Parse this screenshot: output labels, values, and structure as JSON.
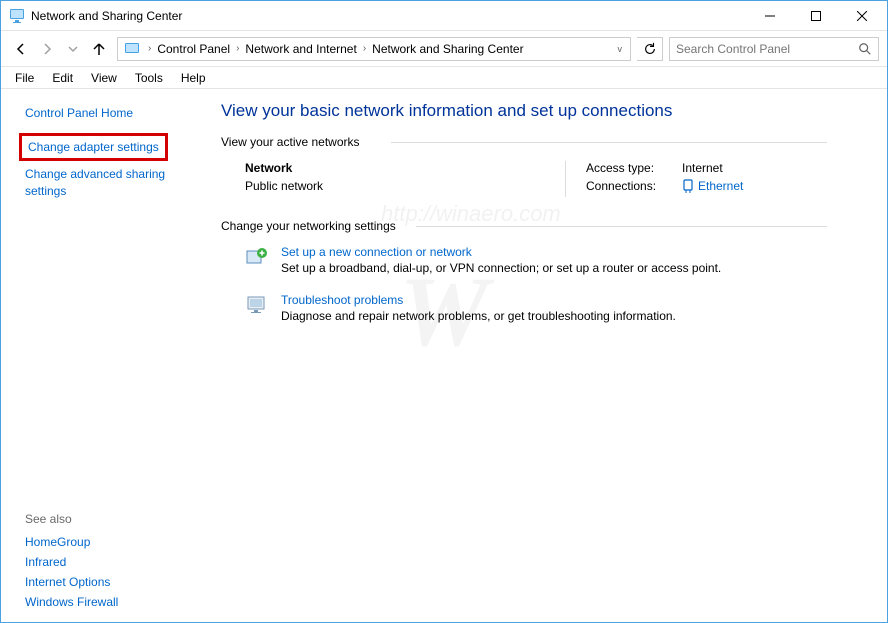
{
  "window": {
    "title": "Network and Sharing Center"
  },
  "breadcrumb": {
    "seg0": "Control Panel",
    "seg1": "Network and Internet",
    "seg2": "Network and Sharing Center"
  },
  "search": {
    "placeholder": "Search Control Panel"
  },
  "menu": {
    "file": "File",
    "edit": "Edit",
    "view": "View",
    "tools": "Tools",
    "help": "Help"
  },
  "sidebar": {
    "home": "Control Panel Home",
    "adapter": "Change adapter settings",
    "advanced": "Change advanced sharing settings",
    "see_also": "See also",
    "links": {
      "homegroup": "HomeGroup",
      "infrared": "Infrared",
      "inetopt": "Internet Options",
      "firewall": "Windows Firewall"
    }
  },
  "main": {
    "title": "View your basic network information and set up connections",
    "active_hd": "View your active networks",
    "network": {
      "name": "Network",
      "type": "Public network"
    },
    "access": {
      "label": "Access type:",
      "value": "Internet"
    },
    "conn": {
      "label": "Connections:",
      "value": "Ethernet"
    },
    "change_hd": "Change your networking settings",
    "setup": {
      "title": "Set up a new connection or network",
      "desc": "Set up a broadband, dial-up, or VPN connection; or set up a router or access point."
    },
    "trouble": {
      "title": "Troubleshoot problems",
      "desc": "Diagnose and repair network problems, or get troubleshooting information."
    }
  },
  "watermark": {
    "big": "W",
    "url": "http://winaero.com"
  }
}
